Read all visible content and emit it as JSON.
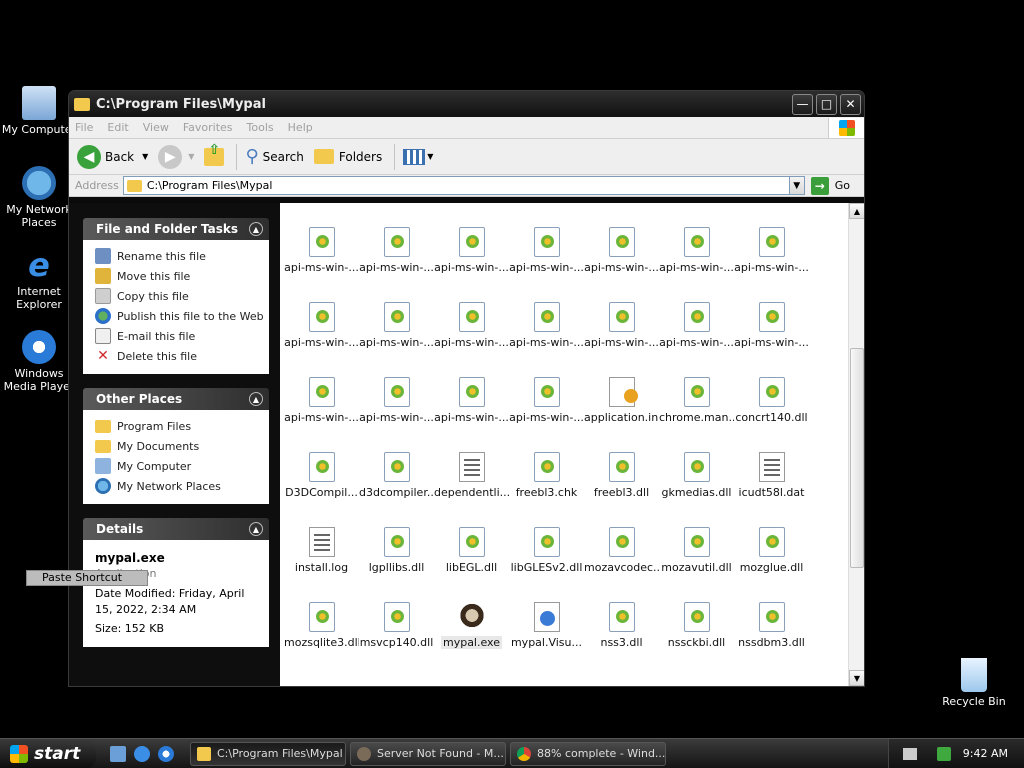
{
  "desktop": {
    "icons": [
      {
        "label": "My Computer"
      },
      {
        "label": "My Network Places"
      },
      {
        "label": "Internet Explorer"
      },
      {
        "label": "Windows Media Player"
      },
      {
        "label": "Recycle Bin"
      }
    ]
  },
  "window": {
    "title": "C:\\Program Files\\Mypal",
    "menu": [
      "File",
      "Edit",
      "View",
      "Favorites",
      "Tools",
      "Help"
    ],
    "toolbar": {
      "back": "Back",
      "search": "Search",
      "folders": "Folders"
    },
    "address": {
      "label": "Address",
      "value": "C:\\Program Files\\Mypal",
      "go": "Go"
    }
  },
  "taskpane": {
    "file_tasks": {
      "title": "File and Folder Tasks",
      "items": [
        "Rename this file",
        "Move this file",
        "Copy this file",
        "Publish this file to the Web",
        "E-mail this file",
        "Delete this file"
      ]
    },
    "other_places": {
      "title": "Other Places",
      "items": [
        "Program Files",
        "My Documents",
        "My Computer",
        "My Network Places"
      ]
    },
    "details": {
      "title": "Details",
      "name": "mypal.exe",
      "type": "Application",
      "modified": "Date Modified: Friday, April 15, 2022, 2:34 AM",
      "size": "Size: 152 KB"
    }
  },
  "files": [
    {
      "name": "api-ms-win-...",
      "kind": "dll"
    },
    {
      "name": "api-ms-win-...",
      "kind": "dll"
    },
    {
      "name": "api-ms-win-...",
      "kind": "dll"
    },
    {
      "name": "api-ms-win-...",
      "kind": "dll"
    },
    {
      "name": "api-ms-win-...",
      "kind": "dll"
    },
    {
      "name": "api-ms-win-...",
      "kind": "dll"
    },
    {
      "name": "api-ms-win-...",
      "kind": "dll"
    },
    {
      "name": "api-ms-win-...",
      "kind": "dll"
    },
    {
      "name": "api-ms-win-...",
      "kind": "dll"
    },
    {
      "name": "api-ms-win-...",
      "kind": "dll"
    },
    {
      "name": "api-ms-win-...",
      "kind": "dll"
    },
    {
      "name": "api-ms-win-...",
      "kind": "dll"
    },
    {
      "name": "api-ms-win-...",
      "kind": "dll"
    },
    {
      "name": "api-ms-win-...",
      "kind": "dll"
    },
    {
      "name": "api-ms-win-...",
      "kind": "dll"
    },
    {
      "name": "api-ms-win-...",
      "kind": "dll"
    },
    {
      "name": "api-ms-win-...",
      "kind": "dll"
    },
    {
      "name": "api-ms-win-...",
      "kind": "dll"
    },
    {
      "name": "application.ini",
      "kind": "ini"
    },
    {
      "name": "chrome.man...",
      "kind": "dll"
    },
    {
      "name": "concrt140.dll",
      "kind": "dll"
    },
    {
      "name": "D3DCompil...",
      "kind": "dll"
    },
    {
      "name": "d3dcompiler...",
      "kind": "dll"
    },
    {
      "name": "dependentli...",
      "kind": "txt"
    },
    {
      "name": "freebl3.chk",
      "kind": "dll"
    },
    {
      "name": "freebl3.dll",
      "kind": "dll"
    },
    {
      "name": "gkmedias.dll",
      "kind": "dll"
    },
    {
      "name": "icudt58l.dat",
      "kind": "txt"
    },
    {
      "name": "install.log",
      "kind": "txt"
    },
    {
      "name": "lgpllibs.dll",
      "kind": "dll"
    },
    {
      "name": "libEGL.dll",
      "kind": "dll"
    },
    {
      "name": "libGLESv2.dll",
      "kind": "dll"
    },
    {
      "name": "mozavcodec...",
      "kind": "dll"
    },
    {
      "name": "mozavutil.dll",
      "kind": "dll"
    },
    {
      "name": "mozglue.dll",
      "kind": "dll"
    },
    {
      "name": "mozsqlite3.dll",
      "kind": "dll"
    },
    {
      "name": "msvcp140.dll",
      "kind": "dll"
    },
    {
      "name": "mypal.exe",
      "kind": "exe",
      "selected": true
    },
    {
      "name": "mypal.Visu...",
      "kind": "web"
    },
    {
      "name": "nss3.dll",
      "kind": "dll"
    },
    {
      "name": "nssckbi.dll",
      "kind": "dll"
    },
    {
      "name": "nssdbm3.dll",
      "kind": "dll"
    }
  ],
  "tooltip": "Paste Shortcut",
  "taskbar": {
    "start": "start",
    "tasks": [
      "C:\\Program Files\\Mypal",
      "Server Not Found - M...",
      "88% complete - Wind..."
    ],
    "clock": "9:42 AM"
  }
}
